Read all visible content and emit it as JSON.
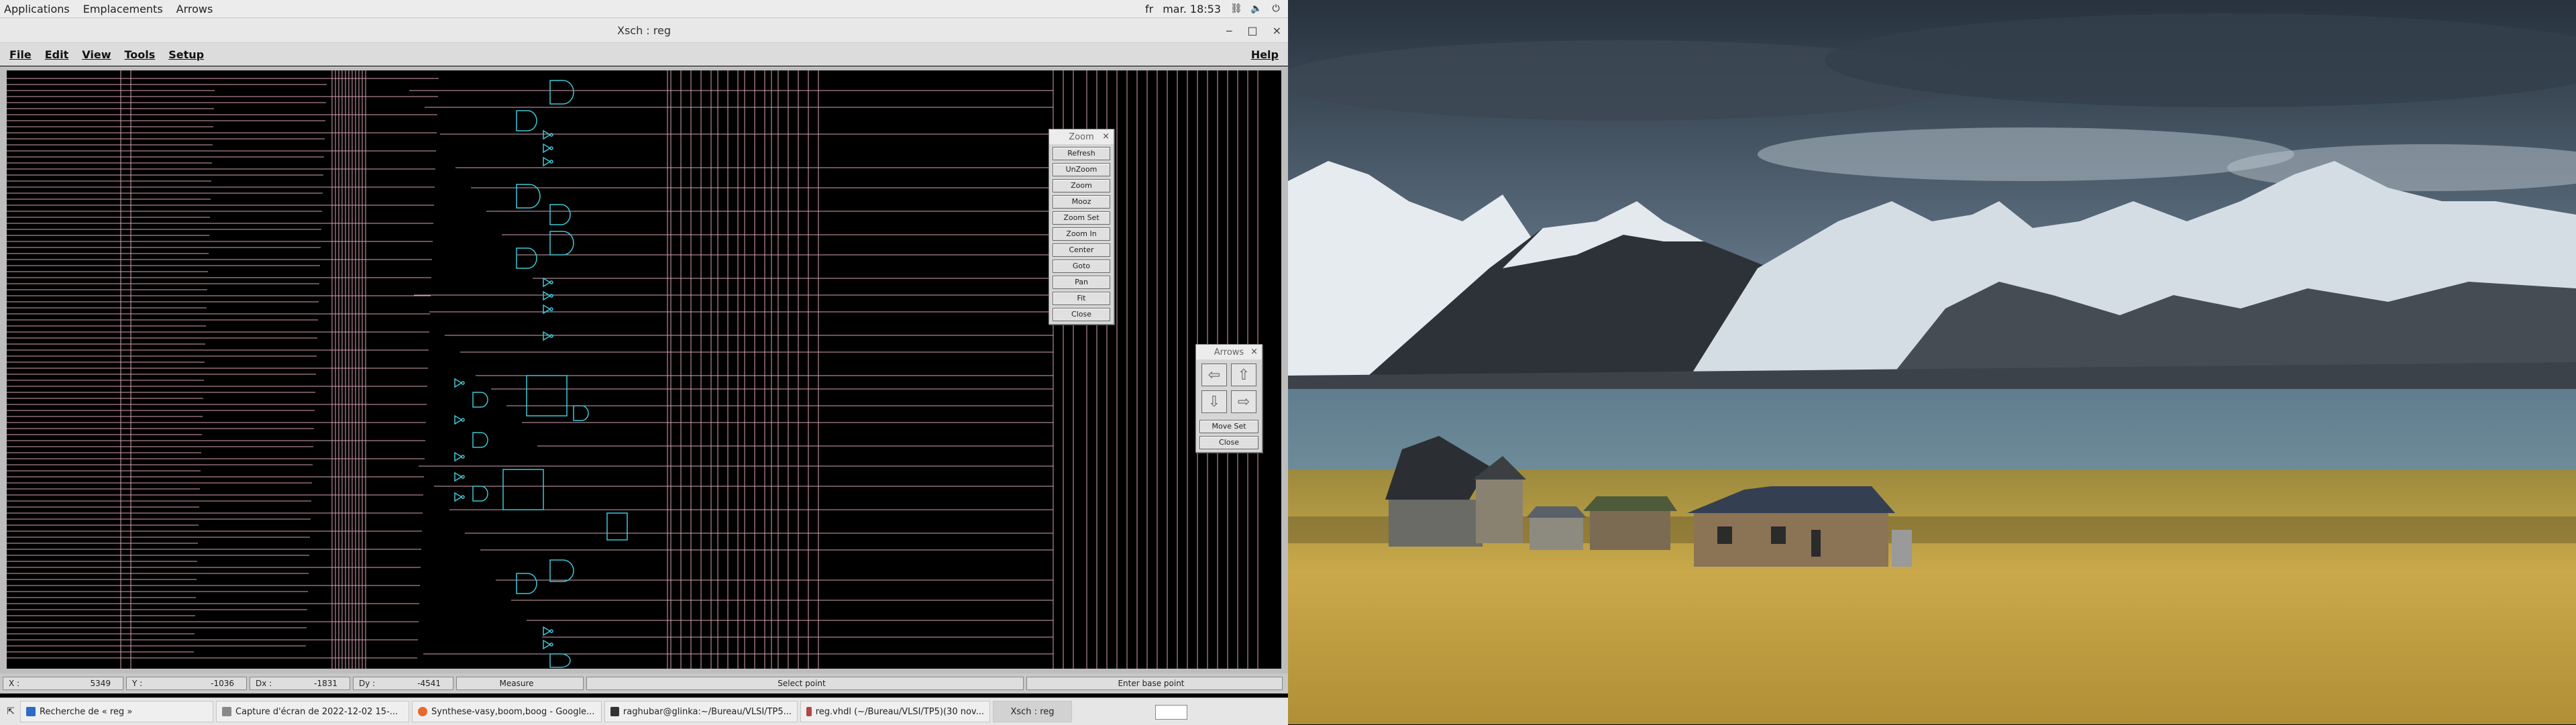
{
  "topbar": {
    "applications": "Applications",
    "places": "Emplacements",
    "arrows": "Arrows",
    "lang": "fr",
    "clock": "mar. 18:53"
  },
  "window": {
    "title": "Xsch : reg",
    "minimize": "‒",
    "maximize": "□",
    "close": "×"
  },
  "menubar": {
    "file": "File",
    "edit": "Edit",
    "view": "View",
    "tools": "Tools",
    "setup": "Setup",
    "help": "Help"
  },
  "zoom_palette": {
    "title": "Zoom",
    "close_x": "×",
    "buttons": [
      "Refresh",
      "UnZoom",
      "Zoom",
      "Mooz",
      "Zoom Set",
      "Zoom In",
      "Center",
      "Goto",
      "Pan",
      "Fit",
      "Close"
    ]
  },
  "arrows_palette": {
    "title": "Arrows",
    "close_x": "×",
    "move_set": "Move Set",
    "close": "Close"
  },
  "status": {
    "x_label": "X :",
    "x_value": "5349",
    "y_label": "Y :",
    "y_value": "-1036",
    "dx_label": "Dx :",
    "dx_value": "-1831",
    "dy_label": "Dy :",
    "dy_value": "-4541",
    "measure": "Measure",
    "select_point": "Select point",
    "enter_base_point": "Enter base point"
  },
  "taskbar": {
    "items": [
      "Recherche de « reg »",
      "Capture d'écran de 2022-12-02 15-...",
      "Synthese-vasy,boom,boog - Google...",
      "raghubar@glinka:~/Bureau/VLSI/TP5...",
      "reg.vhdl (~/Bureau/VLSI/TP5)(30 nov...",
      "Xsch : reg"
    ]
  },
  "colors": {
    "canvas_bg": "#000000",
    "wire": "#d9a3b4",
    "gate": "#3fc7d6"
  }
}
